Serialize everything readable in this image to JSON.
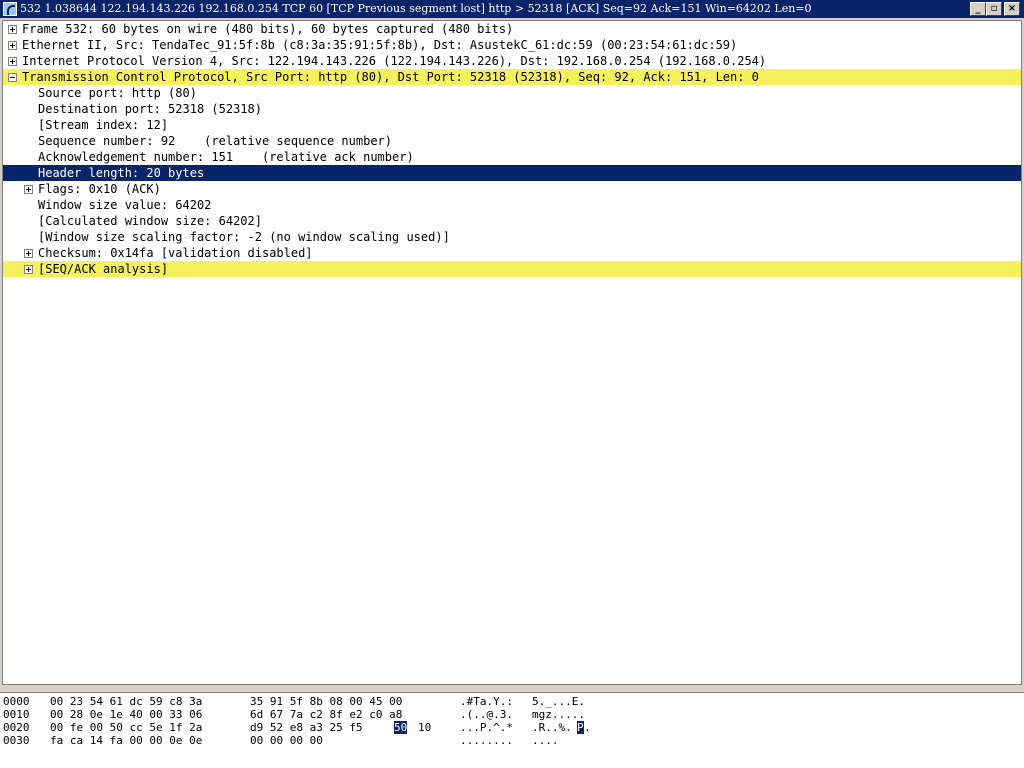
{
  "window": {
    "title": "532 1.038644 122.194.143.226 192.168.0.254 TCP 60 [TCP Previous segment lost] http > 52318 [ACK] Seq=92 Ack=151 Win=64202 Len=0",
    "min_symbol": "_",
    "max_symbol": "▫",
    "close_symbol": "×"
  },
  "tree": [
    {
      "text": "Frame 532: 60 bytes on wire (480 bits), 60 bytes captured (480 bits)",
      "expander": "plus"
    },
    {
      "text": "Ethernet II, Src: TendaTec_91:5f:8b (c8:3a:35:91:5f:8b), Dst: AsustekC_61:dc:59 (00:23:54:61:dc:59)",
      "expander": "plus"
    },
    {
      "text": "Internet Protocol Version 4, Src: 122.194.143.226 (122.194.143.226), Dst: 192.168.0.254 (192.168.0.254)",
      "expander": "plus"
    },
    {
      "text": "Transmission Control Protocol, Src Port: http (80), Dst Port: 52318 (52318), Seq: 92, Ack: 151, Len: 0",
      "expander": "minus"
    },
    {
      "text": "Source port: http (80)"
    },
    {
      "text": "Destination port: 52318 (52318)"
    },
    {
      "text": "[Stream index: 12]"
    },
    {
      "text": "Sequence number: 92    (relative sequence number)"
    },
    {
      "text": "Acknowledgement number: 151    (relative ack number)"
    },
    {
      "text": "Header length: 20 bytes"
    },
    {
      "text": "Flags: 0x10 (ACK)",
      "expander": "plus"
    },
    {
      "text": "Window size value: 64202"
    },
    {
      "text": "[Calculated window size: 64202]"
    },
    {
      "text": "[Window size scaling factor: -2 (no window scaling used)]"
    },
    {
      "text": "Checksum: 0x14fa [validation disabled]",
      "expander": "plus"
    },
    {
      "text": "[SEQ/ACK analysis]",
      "expander": "plus"
    }
  ],
  "hex_dump": [
    {
      "offset": "0000",
      "hex1": "00 23 54 61 dc 59 c8 3a",
      "hex2": "35 91 5f 8b 08 00 45 00",
      "ascii1": ".#Ta.Y.:",
      "ascii2": "5._...E."
    },
    {
      "offset": "0010",
      "hex1": "00 28 0e 1e 40 00 33 06",
      "hex2": "6d 67 7a c2 8f e2 c0 a8",
      "ascii1": ".(..@.3.",
      "ascii2": "mgz....."
    },
    {
      "offset": "0020",
      "hex1": "00 fe 00 50 cc 5e 1f 2a",
      "hex2_pre": "d9 52 e8 a3 25 f5",
      "hex2_sel": "50",
      "hex2_post": "10",
      "ascii1": "...P.^.*",
      "ascii2_pre": ".R..%.",
      "ascii2_sel": "P",
      "ascii2_post": "."
    },
    {
      "offset": "0030",
      "hex1": "fa ca 14 fa 00 00 0e 0e",
      "hex2": "00 00 00 00",
      "ascii1": "........",
      "ascii2": "...."
    }
  ]
}
